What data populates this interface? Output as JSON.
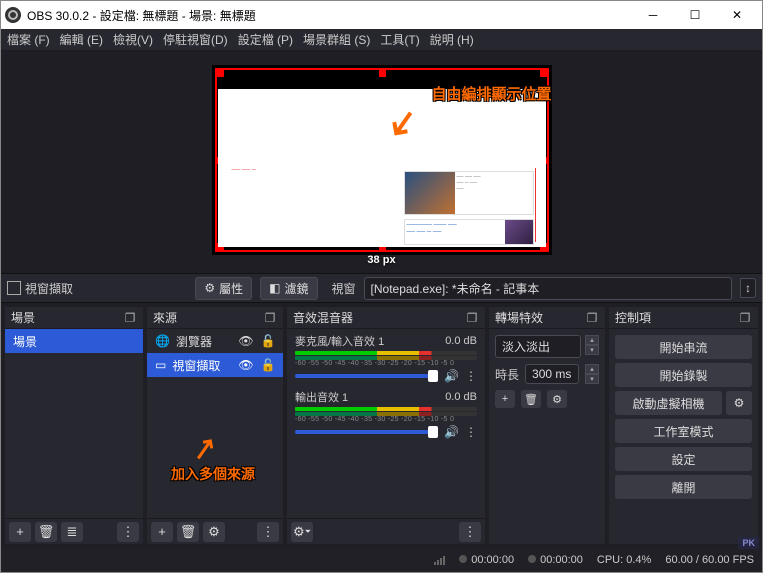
{
  "window": {
    "title": "OBS 30.0.2 - 設定檔: 無標題 - 場景: 無標題"
  },
  "menu": [
    "檔案 (F)",
    "編輯 (E)",
    "檢視(V)",
    "停駐視窗(D)",
    "設定檔 (P)",
    "場景群組 (S)",
    "工具(T)",
    "說明 (H)"
  ],
  "preview": {
    "px_label": "38 px",
    "annotation": "自由編排顯示位置"
  },
  "ctxbar": {
    "source_name": "視窗擷取",
    "properties": "屬性",
    "filters": "濾鏡",
    "window_label": "視窗",
    "window_value": "[Notepad.exe]: *未命名 - 記事本"
  },
  "docks": {
    "scenes": {
      "title": "場景",
      "items": [
        "場景"
      ]
    },
    "sources": {
      "title": "來源",
      "items": [
        {
          "icon": "globe",
          "label": "瀏覽器",
          "selected": false
        },
        {
          "icon": "window",
          "label": "視窗擷取",
          "selected": true
        }
      ],
      "annotation": "加入多個來源"
    },
    "mixer": {
      "title": "音效混音器",
      "channels": [
        {
          "name": "麥克風/輸入音效 1",
          "db": "0.0 dB"
        },
        {
          "name": "輸出音效 1",
          "db": "0.0 dB"
        }
      ],
      "ticks": "-60 -55 -50 -45 -40 -35 -30 -25 -20 -15 -10 -5 0"
    },
    "transitions": {
      "title": "轉場特效",
      "type": "淡入淡出",
      "duration_label": "時長",
      "duration": "300 ms"
    },
    "controls": {
      "title": "控制項",
      "buttons": [
        "開始串流",
        "開始錄製",
        "啟動虛擬相機",
        "工作室模式",
        "設定",
        "離開"
      ]
    }
  },
  "status": {
    "time1": "00:00:00",
    "time2": "00:00:00",
    "cpu": "CPU: 0.4%",
    "fps": "60.00 / 60.00 FPS"
  },
  "watermark": "PK"
}
